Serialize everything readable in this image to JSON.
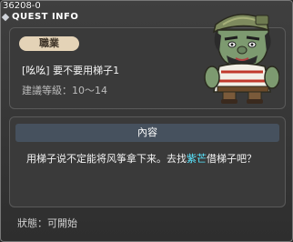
{
  "window": {
    "quest_id": "36208-0",
    "title": "QUEST INFO",
    "close_glyph": "×"
  },
  "summary": {
    "job_label": "職業",
    "quest_name": "[吆吆] 要不要用梯子1",
    "recommend_level": "建議等級：10～14"
  },
  "content": {
    "header": "內容",
    "text_before": "用梯子说不定能将风筝拿下来。去找",
    "npc_name": "紫芒",
    "text_after": "借梯子吧？",
    "npc_color": "#59e6ff"
  },
  "status": {
    "text": "狀態：可開始"
  },
  "icons": {
    "title": "diamond-icon",
    "close": "close-icon",
    "portrait": "npc-portrait"
  }
}
